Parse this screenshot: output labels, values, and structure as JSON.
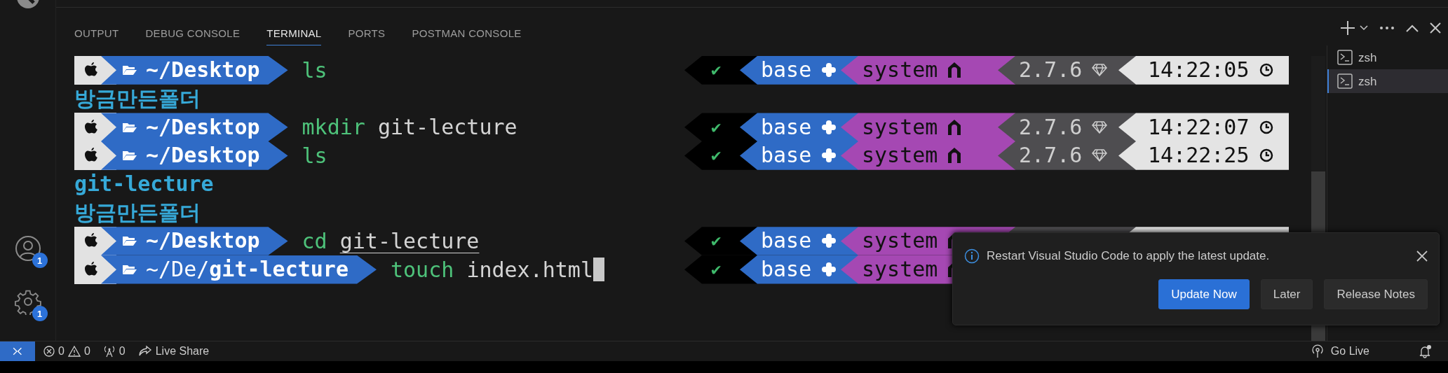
{
  "activity_bar": {
    "badges": [
      {
        "kind": "account",
        "count": "1"
      },
      {
        "kind": "settings",
        "count": "1"
      }
    ]
  },
  "panel": {
    "tabs": [
      {
        "label": "OUTPUT",
        "selected": false
      },
      {
        "label": "DEBUG CONSOLE",
        "selected": false
      },
      {
        "label": "TERMINAL",
        "selected": true
      },
      {
        "label": "PORTS",
        "selected": false
      },
      {
        "label": "POSTMAN CONSOLE",
        "selected": false
      }
    ]
  },
  "terminal": {
    "lines": [
      {
        "kind": "prompt",
        "dir": "~/Desktop",
        "command": "ls",
        "right": {
          "status": "✔",
          "env": "base",
          "node": "system",
          "version": "2.7.6",
          "time": "14:22:05"
        }
      },
      {
        "kind": "output",
        "text": "방금만든폴더"
      },
      {
        "kind": "prompt",
        "dir": "~/Desktop",
        "command": "mkdir",
        "args": "git-lecture",
        "right": {
          "status": "✔",
          "env": "base",
          "node": "system",
          "version": "2.7.6",
          "time": "14:22:07"
        }
      },
      {
        "kind": "prompt",
        "dir": "~/Desktop",
        "command": "ls",
        "right": {
          "status": "✔",
          "env": "base",
          "node": "system",
          "version": "2.7.6",
          "time": "14:22:25"
        }
      },
      {
        "kind": "output",
        "text": "git-lecture"
      },
      {
        "kind": "output",
        "text": "방금만든폴더"
      },
      {
        "kind": "prompt",
        "dir": "~/Desktop",
        "command": "cd",
        "args": "git-lecture",
        "underlined": true,
        "right": {
          "status": "✔",
          "env": "base",
          "node": "system",
          "trailing_segments": true
        }
      },
      {
        "kind": "prompt",
        "dir_parent": "~/De/",
        "dir": "git-lecture",
        "command": "touch",
        "args": "index.html",
        "cursor": true,
        "right": {
          "status": "✔",
          "env": "base",
          "node": "system"
        }
      }
    ]
  },
  "terminal_list": [
    {
      "label": "zsh",
      "selected": false
    },
    {
      "label": "zsh",
      "selected": true
    }
  ],
  "notification": {
    "message": "Restart Visual Studio Code to apply the latest update.",
    "buttons": [
      {
        "label": "Update Now",
        "primary": true
      },
      {
        "label": "Later",
        "primary": false
      },
      {
        "label": "Release Notes",
        "primary": false
      }
    ]
  },
  "status_bar": {
    "errors": "0",
    "warnings": "0",
    "ports": "0",
    "live_share": "Live Share",
    "go_live": "Go Live"
  }
}
